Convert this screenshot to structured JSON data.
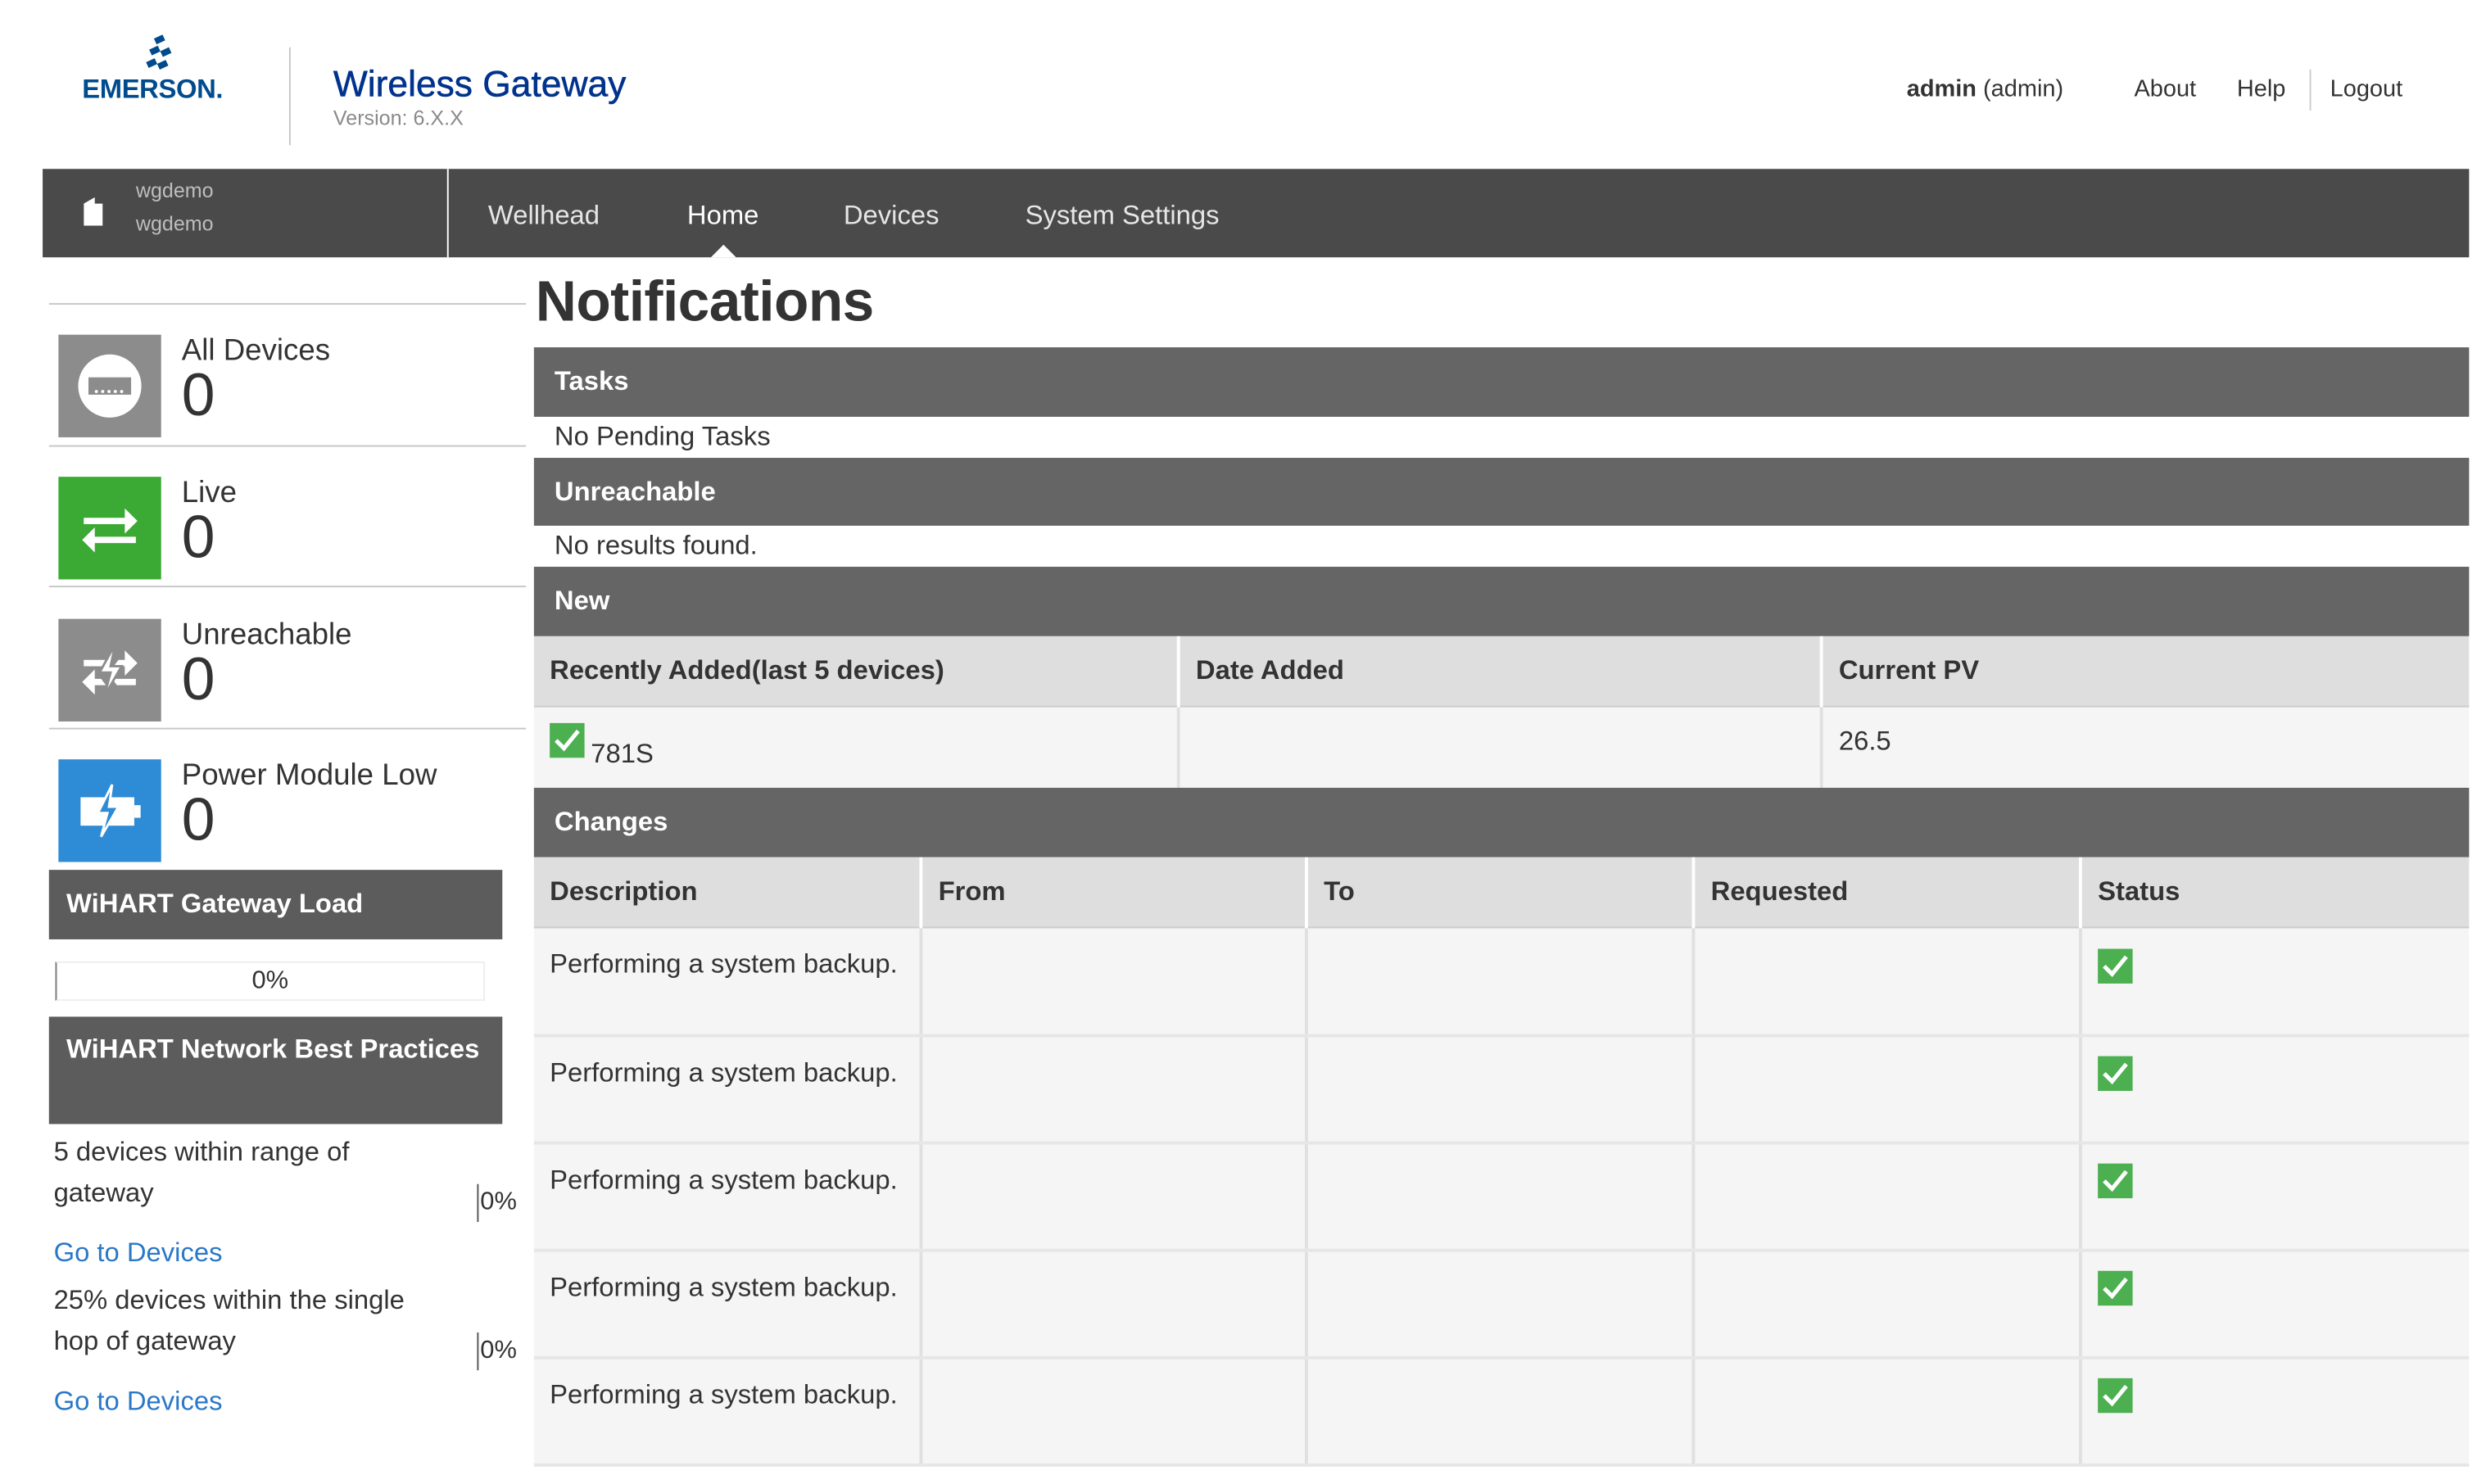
{
  "header": {
    "brand": "EMERSON.",
    "app_title": "Wireless Gateway",
    "version": "Version: 6.X.X",
    "user_name": "admin",
    "user_role": "(admin)",
    "links": [
      "About",
      "Help",
      "Logout"
    ]
  },
  "site": {
    "line1": "wgdemo",
    "line2": "wgdemo"
  },
  "nav": {
    "items": [
      "Wellhead",
      "Home",
      "Devices",
      "System Settings"
    ],
    "active": "Home"
  },
  "sidebar": {
    "stats": [
      {
        "label": "All Devices",
        "count": "0",
        "icon": "device-icon",
        "color": "#8c8c8c"
      },
      {
        "label": "Live",
        "count": "0",
        "icon": "transfer-arrows-icon",
        "color": "#3aaa35"
      },
      {
        "label": "Unreachable",
        "count": "0",
        "icon": "broken-link-icon",
        "color": "#8c8c8c"
      },
      {
        "label": "Power Module Low",
        "count": "0",
        "icon": "battery-low-icon",
        "color": "#2e8bd6"
      }
    ],
    "gateway_load": {
      "title": "WiHART Gateway Load",
      "value": "0%",
      "fraction": 0
    },
    "best_practices": {
      "title": "WiHART Network Best Practices",
      "items": [
        {
          "text": "5 devices within range of gateway",
          "value": "0%",
          "link": "Go to Devices"
        },
        {
          "text": "25% devices within the single hop of gateway",
          "value": "0%",
          "link": "Go to Devices"
        }
      ]
    }
  },
  "main": {
    "title": "Notifications",
    "tasks": {
      "title": "Tasks",
      "empty": "No Pending Tasks"
    },
    "unreachable": {
      "title": "Unreachable",
      "empty": "No results found."
    },
    "new": {
      "title": "New",
      "columns": [
        "Recently Added(last 5 devices)",
        "Date Added",
        "Current PV"
      ],
      "rows": [
        {
          "device": "781S",
          "date_added": "",
          "current_pv": "26.5"
        }
      ]
    },
    "changes": {
      "title": "Changes",
      "columns": [
        "Description",
        "From",
        "To",
        "Requested",
        "Status"
      ],
      "rows": [
        {
          "description": "Performing a system backup.",
          "from": "",
          "to": "",
          "requested": "",
          "status": "check-icon"
        },
        {
          "description": "Performing a system backup.",
          "from": "",
          "to": "",
          "requested": "",
          "status": "check-icon"
        },
        {
          "description": "Performing a system backup.",
          "from": "",
          "to": "",
          "requested": "",
          "status": "check-icon"
        },
        {
          "description": "Performing a system backup.",
          "from": "",
          "to": "",
          "requested": "",
          "status": "check-icon"
        },
        {
          "description": "Performing a system backup.",
          "from": "",
          "to": "",
          "requested": "",
          "status": "check-icon"
        }
      ]
    }
  },
  "colors": {
    "navbar": "#4a4a4a",
    "section_header": "#656565",
    "brand_blue": "#00338d",
    "link_blue": "#2a78c8",
    "success_green": "#4caf50"
  }
}
